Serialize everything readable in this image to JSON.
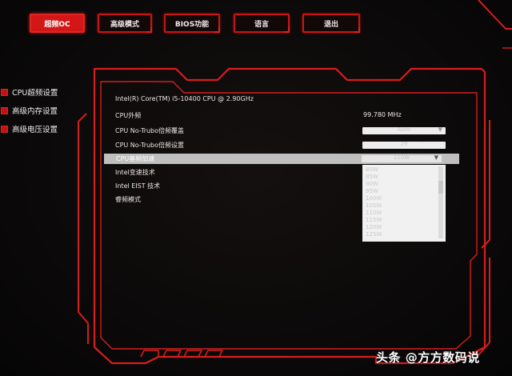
{
  "tabs": [
    {
      "label": "超频OC",
      "active": true
    },
    {
      "label": "高级模式",
      "active": false
    },
    {
      "label": "BIOS功能",
      "active": false
    },
    {
      "label": "语言",
      "active": false
    },
    {
      "label": "退出",
      "active": false
    }
  ],
  "sidebar": {
    "items": [
      {
        "label": "CPU超频设置"
      },
      {
        "label": "高级内存设置"
      },
      {
        "label": "高级电压设置"
      }
    ]
  },
  "settings": {
    "cpu_name": "Intel(R) Core(TM) i5-10400 CPU @ 2.90GHz",
    "rows": [
      {
        "label": "CPU外频",
        "value": "99.780 MHz"
      },
      {
        "label": "CPU No-Trubo倍频覆盖",
        "value": "Auto"
      },
      {
        "label": "CPU No-Trubo倍频设置",
        "value": "29"
      },
      {
        "label": "CPU基频加速",
        "value": "110W"
      },
      {
        "label": "Intel变速技术",
        "value": ""
      },
      {
        "label": "Intel EIST 技术",
        "value": ""
      },
      {
        "label": "睿频模式",
        "value": ""
      }
    ]
  },
  "dropdown": {
    "options": [
      "80W",
      "85W",
      "90W",
      "95W",
      "100W",
      "105W",
      "110W",
      "115W",
      "120W",
      "125W"
    ]
  },
  "watermark": "头条 @方方数码说",
  "colors": {
    "accent": "#d31717",
    "background": "#0b0909",
    "highlight": "#bfbfbf"
  }
}
